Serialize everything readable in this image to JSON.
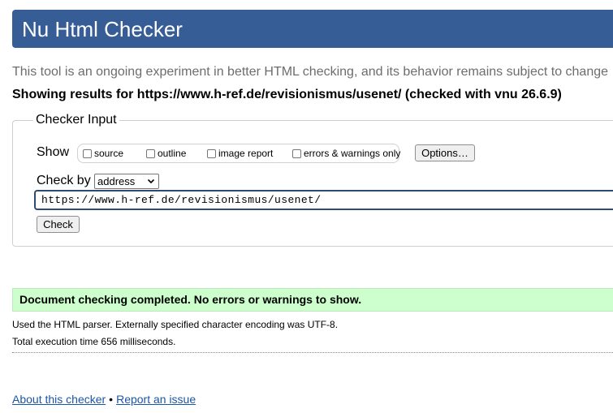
{
  "header": {
    "title": "Nu Html Checker"
  },
  "intro_text": "This tool is an ongoing experiment in better HTML checking, and its behavior remains subject to change",
  "showing_results": "Showing results for https://www.h-ref.de/revisionismus/usenet/ (checked with vnu 26.6.9)",
  "checker_input": {
    "legend": "Checker Input",
    "show_label": "Show",
    "options": [
      {
        "label": "source",
        "checked": false
      },
      {
        "label": "outline",
        "checked": false
      },
      {
        "label": "image report",
        "checked": false
      },
      {
        "label": "errors & warnings only",
        "checked": false
      }
    ],
    "options_button": "Options…",
    "check_by_label": "Check by",
    "check_by_value": "address",
    "url_value": "https://www.h-ref.de/revisionismus/usenet/",
    "check_button": "Check"
  },
  "result": {
    "success_message": "Document checking completed. No errors or warnings to show.",
    "parser_info": "Used the HTML parser. Externally specified character encoding was UTF-8.",
    "execution_time": "Total execution time 656 milliseconds."
  },
  "footer": {
    "about_link": "About this checker",
    "separator": "•",
    "report_link": "Report an issue"
  },
  "colors": {
    "header_bg": "#365d95",
    "success_bg": "#ccffcc",
    "link": "#1a55a6"
  }
}
